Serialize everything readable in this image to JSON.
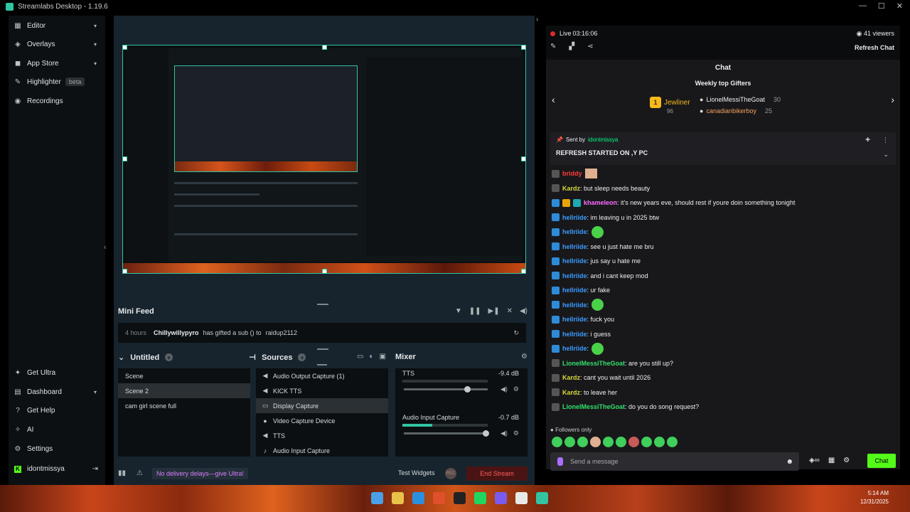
{
  "window": {
    "title": "Streamlabs Desktop - 1.19.6",
    "controls": [
      "—",
      "☐",
      "✕"
    ]
  },
  "sidebar": {
    "top_items": [
      {
        "label": "Editor",
        "icon": "editor-icon",
        "chevron": "▾"
      },
      {
        "label": "Overlays",
        "icon": "overlays-icon",
        "chevron": "▾"
      },
      {
        "label": "App Store",
        "icon": "app-store-icon",
        "chevron": "▾"
      },
      {
        "label": "Highlighter",
        "icon": "highlighter-icon",
        "badge": "beta"
      },
      {
        "label": "Recordings",
        "icon": "recordings-icon"
      }
    ],
    "bottom_items": [
      {
        "label": "Get Ultra",
        "icon": "ultra-icon"
      },
      {
        "label": "Dashboard",
        "icon": "dashboard-icon",
        "chevron": "▾"
      },
      {
        "label": "Get Help",
        "icon": "help-icon"
      },
      {
        "label": "AI",
        "icon": "ai-icon"
      },
      {
        "label": "Settings",
        "icon": "settings-icon"
      }
    ],
    "user": {
      "name": "idontmissya",
      "badge": "K"
    }
  },
  "mini_feed": {
    "title": "Mini Feed",
    "event": {
      "time": "4 hours",
      "user": "Chillywillypyro",
      "text": "has gifted a sub () to",
      "target": "raidup2112"
    }
  },
  "scenes": {
    "title": "Untitled",
    "items": [
      "Scene",
      "Scene 2",
      "cam girl scene full"
    ],
    "selected": 1
  },
  "sources": {
    "title": "Sources",
    "items": [
      {
        "label": "Audio Output Capture (1)",
        "icon": "speaker-icon"
      },
      {
        "label": "KICK TTS",
        "icon": "speaker-icon"
      },
      {
        "label": "Display Capture",
        "icon": "monitor-icon"
      },
      {
        "label": "Video Capture Device",
        "icon": "camera-icon"
      },
      {
        "label": "TTS",
        "icon": "speaker-icon"
      },
      {
        "label": "Audio Input Capture",
        "icon": "mic-icon"
      }
    ],
    "selected": 2
  },
  "mixer": {
    "title": "Mixer",
    "channels": [
      {
        "name": "TTS",
        "db": "-9.4 dB",
        "level": 0,
        "volume": 0.76
      },
      {
        "name": "Audio Input Capture",
        "db": "-0.7 dB",
        "level": 0.35,
        "volume": 0.98
      }
    ]
  },
  "footer": {
    "ultra_banner": "No delivery delays—give Ultra!",
    "test_widgets": "Test Widgets",
    "rec_label": "REC",
    "end_stream": "End Stream"
  },
  "stream": {
    "status": "Live",
    "duration": "03:16:06",
    "viewers": "41 viewers",
    "refresh": "Refresh Chat"
  },
  "chat": {
    "title": "Chat",
    "gifters_title": "Weekly top Gifters",
    "top_gifter": {
      "rank": "1",
      "name": "Jewliner",
      "count": "96"
    },
    "gifters": [
      {
        "name": "LionelMessiTheGoat",
        "count": "30"
      },
      {
        "name": "canadianbikerboy",
        "count": "25"
      }
    ],
    "pinned": {
      "sent_by_label": "Sent by",
      "sender": "idontmissya",
      "message": "REFRESH STARTED ON ,Y PC"
    },
    "messages": [
      {
        "badges": [
          "grey"
        ],
        "user": "briddy",
        "color": "red",
        "text": "",
        "emote": "face"
      },
      {
        "badges": [
          "grey"
        ],
        "user": "Kardz",
        "color": "yellow",
        "text": ": but sleep needs beauty"
      },
      {
        "badges": [
          "blue",
          "gold",
          "teal"
        ],
        "user": "khameleon",
        "color": "pink",
        "text": ": it's new years eve, should rest if youre doin something tonight"
      },
      {
        "badges": [
          "blue"
        ],
        "user": "hellriide",
        "color": "blue",
        "text": ": im leaving u in 2025 btw"
      },
      {
        "badges": [
          "blue"
        ],
        "user": "hellriide",
        "color": "blue",
        "text": ":",
        "emote": "green"
      },
      {
        "badges": [
          "blue"
        ],
        "user": "hellriide",
        "color": "blue",
        "text": ": see u just hate me bru"
      },
      {
        "badges": [
          "blue"
        ],
        "user": "hellriide",
        "color": "blue",
        "text": ": jus say u hate me"
      },
      {
        "badges": [
          "blue"
        ],
        "user": "hellriide",
        "color": "blue",
        "text": ": and i cant keep mod"
      },
      {
        "badges": [
          "blue"
        ],
        "user": "hellriide",
        "color": "blue",
        "text": ": ur fake"
      },
      {
        "badges": [
          "blue"
        ],
        "user": "hellriide",
        "color": "blue",
        "text": ":",
        "emote": "green"
      },
      {
        "badges": [
          "blue"
        ],
        "user": "hellriide",
        "color": "blue",
        "text": ": fuck you"
      },
      {
        "badges": [
          "blue"
        ],
        "user": "hellriide",
        "color": "blue",
        "text": ": i guess"
      },
      {
        "badges": [
          "blue"
        ],
        "user": "hellriide",
        "color": "blue",
        "text": ":",
        "emote": "green"
      },
      {
        "badges": [
          "grey"
        ],
        "user": "LionelMessiTheGoat",
        "color": "green",
        "text": ": are you still up?"
      },
      {
        "badges": [
          "grey"
        ],
        "user": "Kardz",
        "color": "yellow",
        "text": ": cant you wait until 2026"
      },
      {
        "badges": [
          "grey"
        ],
        "user": "Kardz",
        "color": "yellow",
        "text": ": to leave her"
      },
      {
        "badges": [
          "grey"
        ],
        "user": "LionelMessiTheGoat",
        "color": "green",
        "text": ": do you do song request?"
      }
    ],
    "followers_only": "Followers only",
    "input_placeholder": "Send a message",
    "send_button": "Chat"
  },
  "taskbar": {
    "time": "5:14 AM",
    "date": "12/31/2025"
  },
  "colors": {
    "accent": "#31c3a2",
    "kick_green": "#53fc18",
    "live_red": "#e02a2a",
    "end_stream": "#ff5c5c"
  }
}
